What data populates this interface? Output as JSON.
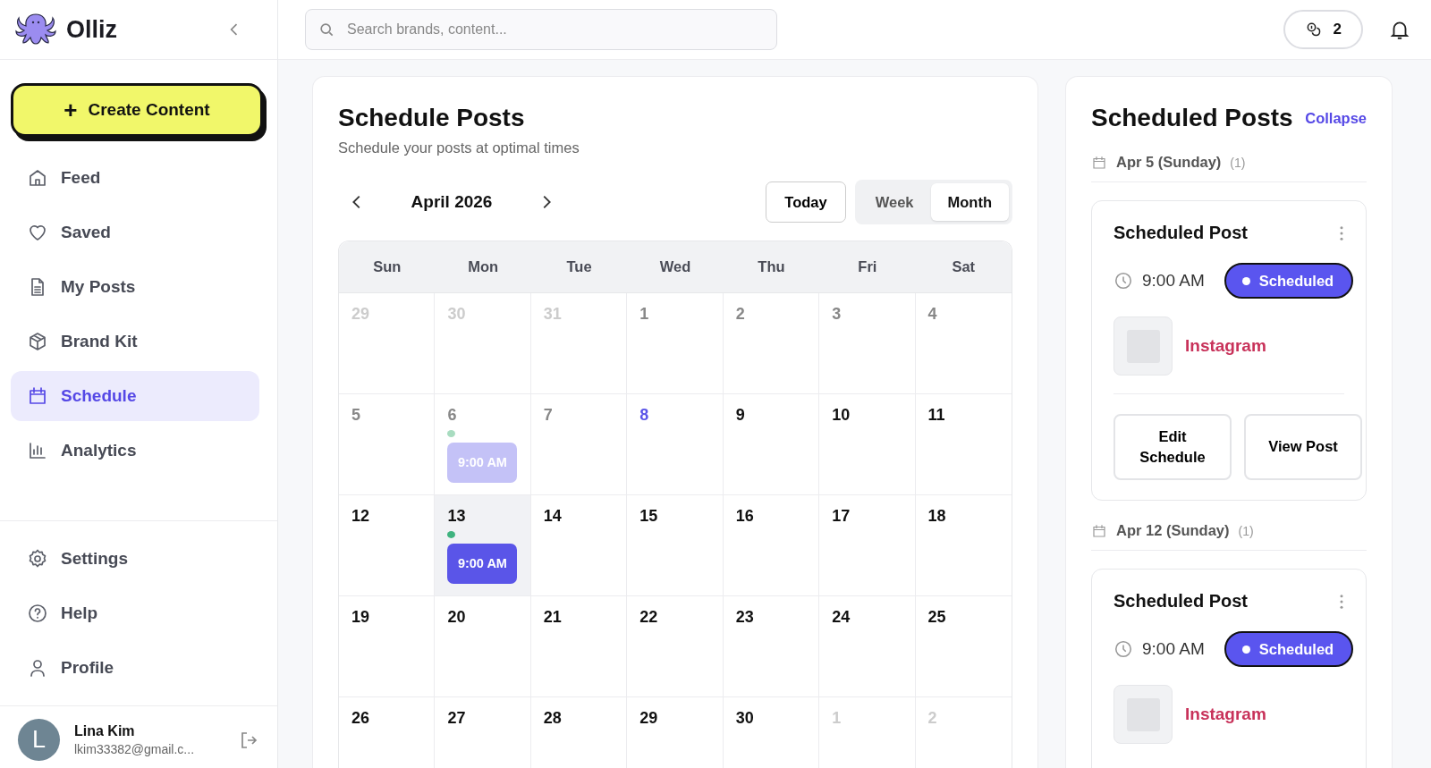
{
  "sidebar": {
    "logo": "Olliz",
    "create_button": {
      "icon": "+",
      "label": "Create Content"
    },
    "nav": [
      {
        "label": "Feed",
        "selected": false
      },
      {
        "label": "Saved",
        "selected": false
      },
      {
        "label": "My Posts",
        "selected": false
      },
      {
        "label": "Brand Kit",
        "selected": false
      },
      {
        "label": "Schedule",
        "selected": true
      },
      {
        "label": "Analytics",
        "selected": false
      }
    ],
    "bottom_nav": [
      {
        "label": "Settings",
        "selected": false
      },
      {
        "label": "Help",
        "selected": false
      },
      {
        "label": "Profile",
        "selected": false
      }
    ],
    "user": {
      "initial": "L",
      "name": "Lina Kim",
      "email": "lkim33382@gmail.c..."
    }
  },
  "header": {
    "search": {
      "placeholder": "Search brands, content..."
    },
    "credits": "2"
  },
  "schedule": {
    "title": "Schedule Posts",
    "subtitle": "Schedule your posts at optimal times",
    "month": "April 2026",
    "today_button": "Today",
    "views": [
      {
        "label": "Week",
        "selected": false
      },
      {
        "label": "Month",
        "selected": true
      }
    ],
    "weekdays": [
      "Sun",
      "Mon",
      "Tue",
      "Wed",
      "Thu",
      "Fri",
      "Sat"
    ],
    "days": [
      {
        "label": "29",
        "kind": "other",
        "selected": false
      },
      {
        "label": "30",
        "kind": "other",
        "selected": false
      },
      {
        "label": "31",
        "kind": "other",
        "selected": false
      },
      {
        "label": "1",
        "kind": "past",
        "selected": false
      },
      {
        "label": "2",
        "kind": "past",
        "selected": false
      },
      {
        "label": "3",
        "kind": "past",
        "selected": false
      },
      {
        "label": "4",
        "kind": "past",
        "selected": false
      },
      {
        "label": "5",
        "kind": "past",
        "selected": false
      },
      {
        "label": "6",
        "kind": "past",
        "selected": false,
        "events": [
          {
            "time": "9:00 AM",
            "color": "#a8dcc0",
            "past": true
          }
        ]
      },
      {
        "label": "7",
        "kind": "past",
        "selected": false
      },
      {
        "label": "8",
        "kind": "today",
        "selected": false
      },
      {
        "label": "9",
        "kind": "future",
        "selected": false
      },
      {
        "label": "10",
        "kind": "future",
        "selected": false
      },
      {
        "label": "11",
        "kind": "future",
        "selected": false
      },
      {
        "label": "12",
        "kind": "future",
        "selected": false
      },
      {
        "label": "13",
        "kind": "future",
        "selected": true,
        "events": [
          {
            "time": "9:00 AM",
            "color": "#3fb37f",
            "past": false
          }
        ]
      },
      {
        "label": "14",
        "kind": "future",
        "selected": false
      },
      {
        "label": "15",
        "kind": "future",
        "selected": false
      },
      {
        "label": "16",
        "kind": "future",
        "selected": false
      },
      {
        "label": "17",
        "kind": "future",
        "selected": false
      },
      {
        "label": "18",
        "kind": "future",
        "selected": false
      },
      {
        "label": "19",
        "kind": "future",
        "selected": false
      },
      {
        "label": "20",
        "kind": "future",
        "selected": false
      },
      {
        "label": "21",
        "kind": "future",
        "selected": false
      },
      {
        "label": "22",
        "kind": "future",
        "selected": false
      },
      {
        "label": "23",
        "kind": "future",
        "selected": false
      },
      {
        "label": "24",
        "kind": "future",
        "selected": false
      },
      {
        "label": "25",
        "kind": "future",
        "selected": false
      },
      {
        "label": "26",
        "kind": "future",
        "selected": false
      },
      {
        "label": "27",
        "kind": "future",
        "selected": false
      },
      {
        "label": "28",
        "kind": "future",
        "selected": false
      },
      {
        "label": "29",
        "kind": "future",
        "selected": false
      },
      {
        "label": "30",
        "kind": "future",
        "selected": false
      },
      {
        "label": "1",
        "kind": "other",
        "selected": false
      },
      {
        "label": "2",
        "kind": "other",
        "selected": false
      }
    ]
  },
  "scheduled_posts": {
    "title": "Scheduled Posts",
    "collapse": "Collapse",
    "groups": [
      {
        "date": "Apr 5 (Sunday)",
        "count": "(1)",
        "posts": [
          {
            "title": "Scheduled Post",
            "time": "9:00 AM",
            "status": "Scheduled",
            "platform": "Instagram",
            "actions": [
              "Edit Schedule",
              "View Post"
            ]
          }
        ]
      },
      {
        "date": "Apr 12 (Sunday)",
        "count": "(1)",
        "posts": [
          {
            "title": "Scheduled Post",
            "time": "9:00 AM",
            "status": "Scheduled",
            "platform": "Instagram"
          }
        ]
      }
    ]
  }
}
